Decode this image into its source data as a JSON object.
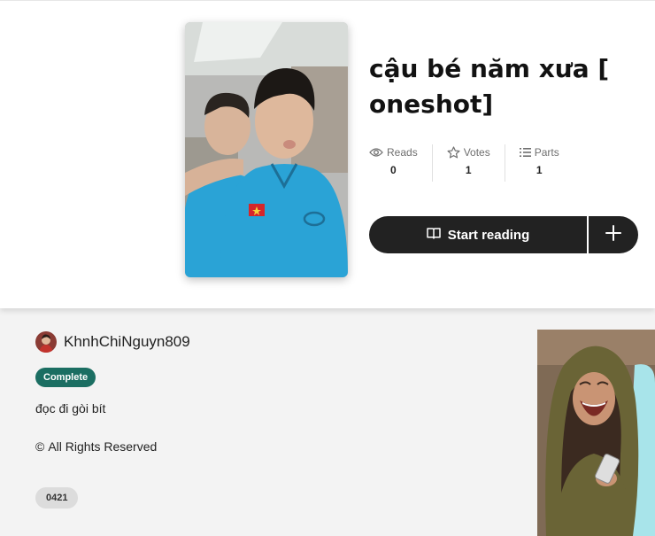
{
  "story": {
    "title": "cậu bé năm xưa [ oneshot]",
    "stats": [
      {
        "label": "Reads",
        "value": "0",
        "icon": "eye-icon"
      },
      {
        "label": "Votes",
        "value": "1",
        "icon": "star-icon"
      },
      {
        "label": "Parts",
        "value": "1",
        "icon": "list-icon"
      }
    ],
    "start_reading_label": "Start reading",
    "add_icon": "plus-icon"
  },
  "author": {
    "name": "KhnhChiNguyn809"
  },
  "details": {
    "status_badge": "Complete",
    "description": "đọc đi gòi bít",
    "copyright_symbol": "©",
    "copyright_text": "All Rights Reserved",
    "tag": "0421"
  },
  "colors": {
    "badge": "#1b6e62",
    "button": "#222222",
    "cover_shirt": "#2aa3d6",
    "ad_background": "#a8e4ea"
  }
}
